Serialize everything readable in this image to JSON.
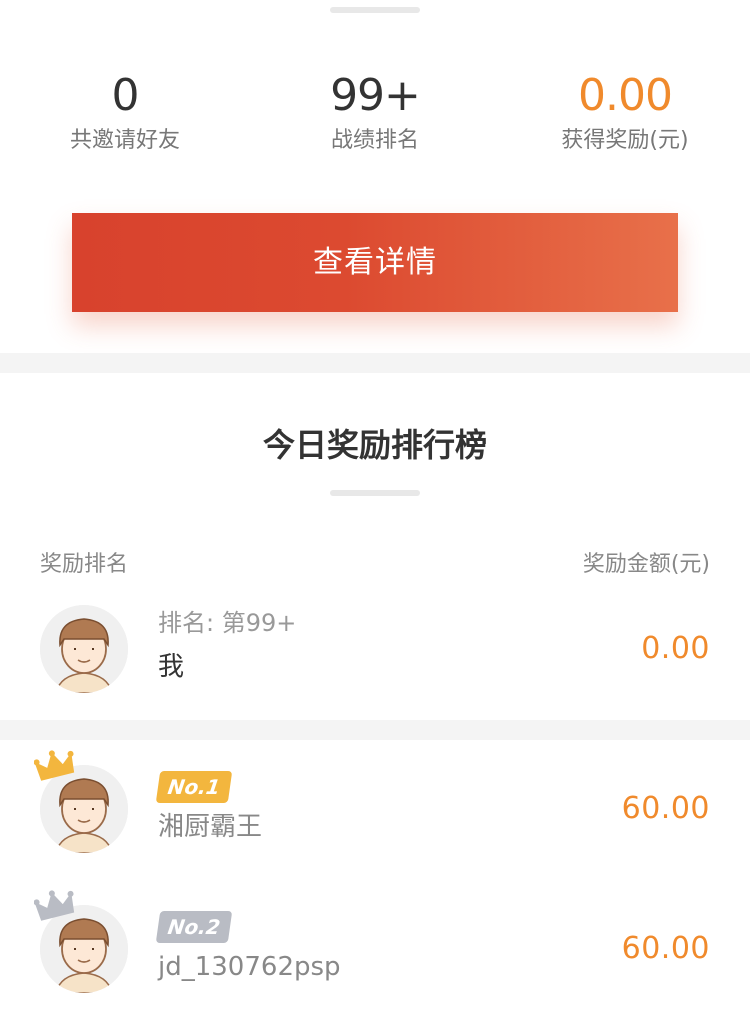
{
  "stats": [
    {
      "value": "0",
      "label": "共邀请好友"
    },
    {
      "value": "99+",
      "label": "战绩排名"
    },
    {
      "value": "0.00",
      "label": "获得奖励(元)"
    }
  ],
  "detail_button": "查看详情",
  "leaderboard": {
    "title": "今日奖励排行榜",
    "col_rank": "奖励排名",
    "col_amount": "奖励金额(元)"
  },
  "me": {
    "rank_text": "排名: 第99+",
    "name": "我",
    "amount": "0.00"
  },
  "entries": [
    {
      "badge": "No.1",
      "name": "湘厨霸王",
      "amount": "60.00",
      "crown": "gold-crown-icon"
    },
    {
      "badge": "No.2",
      "name": "jd_130762psp",
      "amount": "60.00",
      "crown": "silver-crown-icon"
    }
  ],
  "colors": {
    "accent_orange": "#f08a2c",
    "button_red": "#d8422d",
    "gold": "#f3b63e",
    "silver": "#b9bcc4"
  }
}
